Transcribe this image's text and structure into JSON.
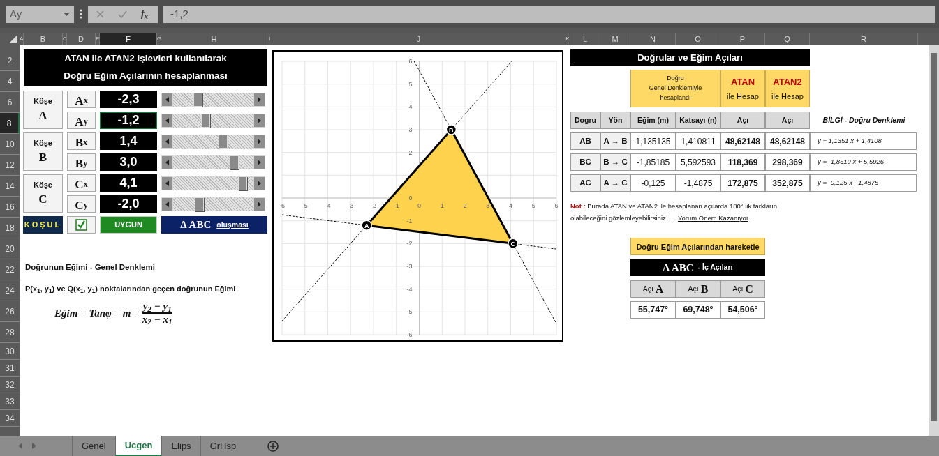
{
  "toolbar": {
    "name_box": "Ay",
    "function_label": "f$_{x}$",
    "formula": "-1,2"
  },
  "columns": [
    {
      "label": "A",
      "selected": false
    },
    {
      "label": "B",
      "selected": false
    },
    {
      "label": "C",
      "selected": false
    },
    {
      "label": "D",
      "selected": false
    },
    {
      "label": "E",
      "selected": false
    },
    {
      "label": "F",
      "selected": true
    },
    {
      "label": "G",
      "selected": false
    },
    {
      "label": "H",
      "selected": false
    },
    {
      "label": "I",
      "selected": false
    },
    {
      "label": "J",
      "selected": false
    },
    {
      "label": "K",
      "selected": false
    },
    {
      "label": "L",
      "selected": false
    },
    {
      "label": "M",
      "selected": false
    },
    {
      "label": "N",
      "selected": false
    },
    {
      "label": "O",
      "selected": false
    },
    {
      "label": "P",
      "selected": false
    },
    {
      "label": "Q",
      "selected": false
    },
    {
      "label": "R",
      "selected": false
    }
  ],
  "rows": [
    {
      "label": "2",
      "selected": false
    },
    {
      "label": "4",
      "selected": false
    },
    {
      "label": "6",
      "selected": false
    },
    {
      "label": "8",
      "selected": true
    },
    {
      "label": "10",
      "selected": false
    },
    {
      "label": "12",
      "selected": false
    },
    {
      "label": "14",
      "selected": false
    },
    {
      "label": "16",
      "selected": false
    },
    {
      "label": "18",
      "selected": false
    },
    {
      "label": "20",
      "selected": false
    },
    {
      "label": "22",
      "selected": false
    },
    {
      "label": "24",
      "selected": false
    },
    {
      "label": "26",
      "selected": false
    },
    {
      "label": "28",
      "selected": false
    },
    {
      "label": "30",
      "selected": false
    },
    {
      "label": "31",
      "selected": false
    },
    {
      "label": "32",
      "selected": false
    },
    {
      "label": "33",
      "selected": false
    },
    {
      "label": "34",
      "selected": false
    }
  ],
  "left": {
    "title": [
      "ATAN  ile  ATAN2 işlevleri kullanılarak",
      "Doğru Eğim Açılarının hesaplanması"
    ],
    "corners": [
      {
        "label": "Köşe",
        "letter": "A",
        "coords": [
          {
            "axis": "A",
            "sub": "x",
            "value": "-2,3",
            "level": 0.3,
            "selected": false
          },
          {
            "axis": "A",
            "sub": "y",
            "value": "-1,2",
            "level": 0.4,
            "selected": true
          }
        ]
      },
      {
        "label": "Köşe",
        "letter": "B",
        "coords": [
          {
            "axis": "B",
            "sub": "x",
            "value": "1,4",
            "level": 0.62,
            "selected": false
          },
          {
            "axis": "B",
            "sub": "y",
            "value": "3,0",
            "level": 0.76,
            "selected": false
          }
        ]
      },
      {
        "label": "Köşe",
        "letter": "C",
        "coords": [
          {
            "axis": "C",
            "sub": "x",
            "value": "4,1",
            "level": 0.86,
            "selected": false
          },
          {
            "axis": "C",
            "sub": "y",
            "value": "-2,0",
            "level": 0.32,
            "selected": false
          }
        ]
      }
    ],
    "condition": {
      "label": "KOŞUL",
      "checked": true,
      "status": "UYGUN",
      "triangle": "Δ ABC",
      "suffix": "oluşması"
    },
    "slope": {
      "heading": "Doğrunun Eğimi  - Genel Denklemi",
      "sentence": "P(x$_{1}$, y$_{1}$)  ve  Q(x$_{1}$, y$_{1}$)  noktalarından geçen doğrunun Eğimi",
      "lhs": "Eğim = Tanφ = m =",
      "numerator": "y$_{2}$ − y$_{1}$",
      "denominator": "x$_{2}$ − x$_{1}$"
    }
  },
  "chart": {
    "chart_data": {
      "type": "scatter",
      "x": [
        -2.3,
        1.4,
        4.1
      ],
      "series": [
        {
          "color": "#000000",
          "values": [
            -1.2,
            3.0,
            -2.0
          ]
        }
      ],
      "grid": true,
      "xlim": [
        -6,
        6
      ],
      "ylim": [
        -6,
        6
      ],
      "xticks": [
        -6,
        -5,
        -4,
        -3,
        -2,
        -1,
        0,
        1,
        2,
        3,
        4,
        5,
        6
      ],
      "yticks": [
        -6,
        -5,
        -4,
        -3,
        -2,
        -1,
        0,
        2,
        3,
        4,
        5,
        6
      ],
      "annotations": [
        {
          "x": -2.3,
          "y": -1.2,
          "text": "A"
        },
        {
          "x": 1.4,
          "y": 3.0,
          "text": "B"
        },
        {
          "x": 4.1,
          "y": -2.0,
          "text": "C"
        }
      ]
    }
  },
  "right": {
    "title": "Doğrular ve Eğim Açıları",
    "general_header": [
      "Doğru",
      "Genel Denklemiyle",
      "hesaplandı"
    ],
    "function_headers": [
      {
        "name": "ATAN",
        "caption": "ile Hesap"
      },
      {
        "name": "ATAN2",
        "caption": "ile Hesap"
      }
    ],
    "columns": [
      "Dogru",
      "Yön",
      "Eğim (m)",
      "Katsayı (n)",
      "Açı",
      "Açı"
    ],
    "info_heading": "BİLGİ - Doğru Denklemi",
    "rows": [
      {
        "line": "AB",
        "direction": "A → B",
        "slope": "1,135135",
        "intercept": "1,410811",
        "atan": "48,62148",
        "atan2": "48,62148",
        "equation": "y = 1,1351 x + 1,4108"
      },
      {
        "line": "BC",
        "direction": "B → C",
        "slope": "-1,85185",
        "intercept": "5,592593",
        "atan": "118,369",
        "atan2": "298,369",
        "equation": "y = -1,8519 x + 5,5926"
      },
      {
        "line": "AC",
        "direction": "A → C",
        "slope": "-0,125",
        "intercept": "-1,4875",
        "atan": "172,875",
        "atan2": "352,875",
        "equation": "y = -0,125 x - 1,4875"
      }
    ],
    "note": {
      "label": "Not :",
      "text": "Burada ATAN  ve  ATAN2 ile hesaplanan açılarda 180° lik farkların olabileceğini gözlemleyebilirsiniz…..",
      "link": "Yorum Önem Kazanıyor",
      "tail": ".."
    },
    "angles": {
      "button": "Doğru Eğim Açılarından hareketle",
      "banner_symbol": "Δ ABC",
      "banner_text": "-  İç Açıları",
      "items": [
        {
          "label": "Açı",
          "letter": "A",
          "value": "55,747°"
        },
        {
          "label": "Açı",
          "letter": "B",
          "value": "69,748°"
        },
        {
          "label": "Açı",
          "letter": "C",
          "value": "54,506°"
        }
      ]
    }
  },
  "sheet_tabs": [
    {
      "label": "Genel",
      "selected": false
    },
    {
      "label": "Ucgen",
      "selected": true
    },
    {
      "label": "Elips",
      "selected": false
    },
    {
      "label": "GrHsp",
      "selected": false
    }
  ]
}
